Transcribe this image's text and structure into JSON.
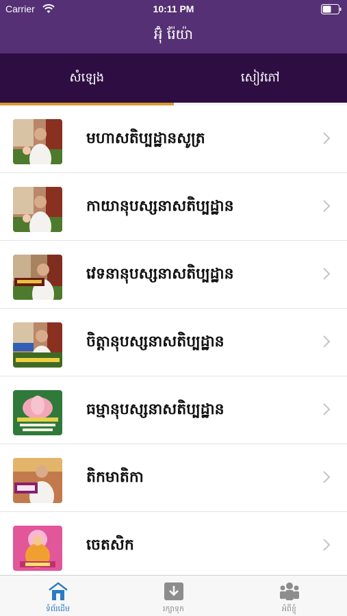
{
  "status_bar": {
    "carrier": "Carrier",
    "time": "10:11 PM"
  },
  "nav": {
    "title": "អ៊ុំ រ៉ែយ៉ា"
  },
  "tabs": [
    {
      "label": "សំឡេង",
      "active": true
    },
    {
      "label": "សៀវភៅ",
      "active": false
    }
  ],
  "colors": {
    "nav_bg": "#553074",
    "tabs_bg": "#2e0e42",
    "tab_indicator": "#d89a2d",
    "active_tab_item": "#2d7ac4"
  },
  "items": [
    {
      "title": "មហាសតិប្បដ្ឋានសូត្រ",
      "thumb_icon": "monk-portrait-thumbnail"
    },
    {
      "title": "កាយានុបស្សនាសតិប្បដ្ឋាន",
      "thumb_icon": "monk-portrait-thumbnail"
    },
    {
      "title": "វេទនានុបស្សនាសតិប្បដ្ឋាន",
      "thumb_icon": "monk-portrait-thumbnail"
    },
    {
      "title": "ចិត្តានុបស្សនាសតិប្បដ្ឋាន",
      "thumb_icon": "monk-portrait-thumbnail"
    },
    {
      "title": "ធម្មានុបស្សនាសតិប្បដ្ឋាន",
      "thumb_icon": "lotus-thumbnail"
    },
    {
      "title": "តិកមាតិកា",
      "thumb_icon": "monk-portrait-thumbnail"
    },
    {
      "title": "ចេតសិក",
      "thumb_icon": "buddha-thumbnail"
    }
  ],
  "tab_bar": [
    {
      "label": "ទំព័រដើម",
      "icon": "home-icon",
      "active": true
    },
    {
      "label": "រក្សាទុក",
      "icon": "download-box-icon",
      "active": false
    },
    {
      "label": "អំពីខ្ញុំ",
      "icon": "people-icon",
      "active": false
    }
  ]
}
